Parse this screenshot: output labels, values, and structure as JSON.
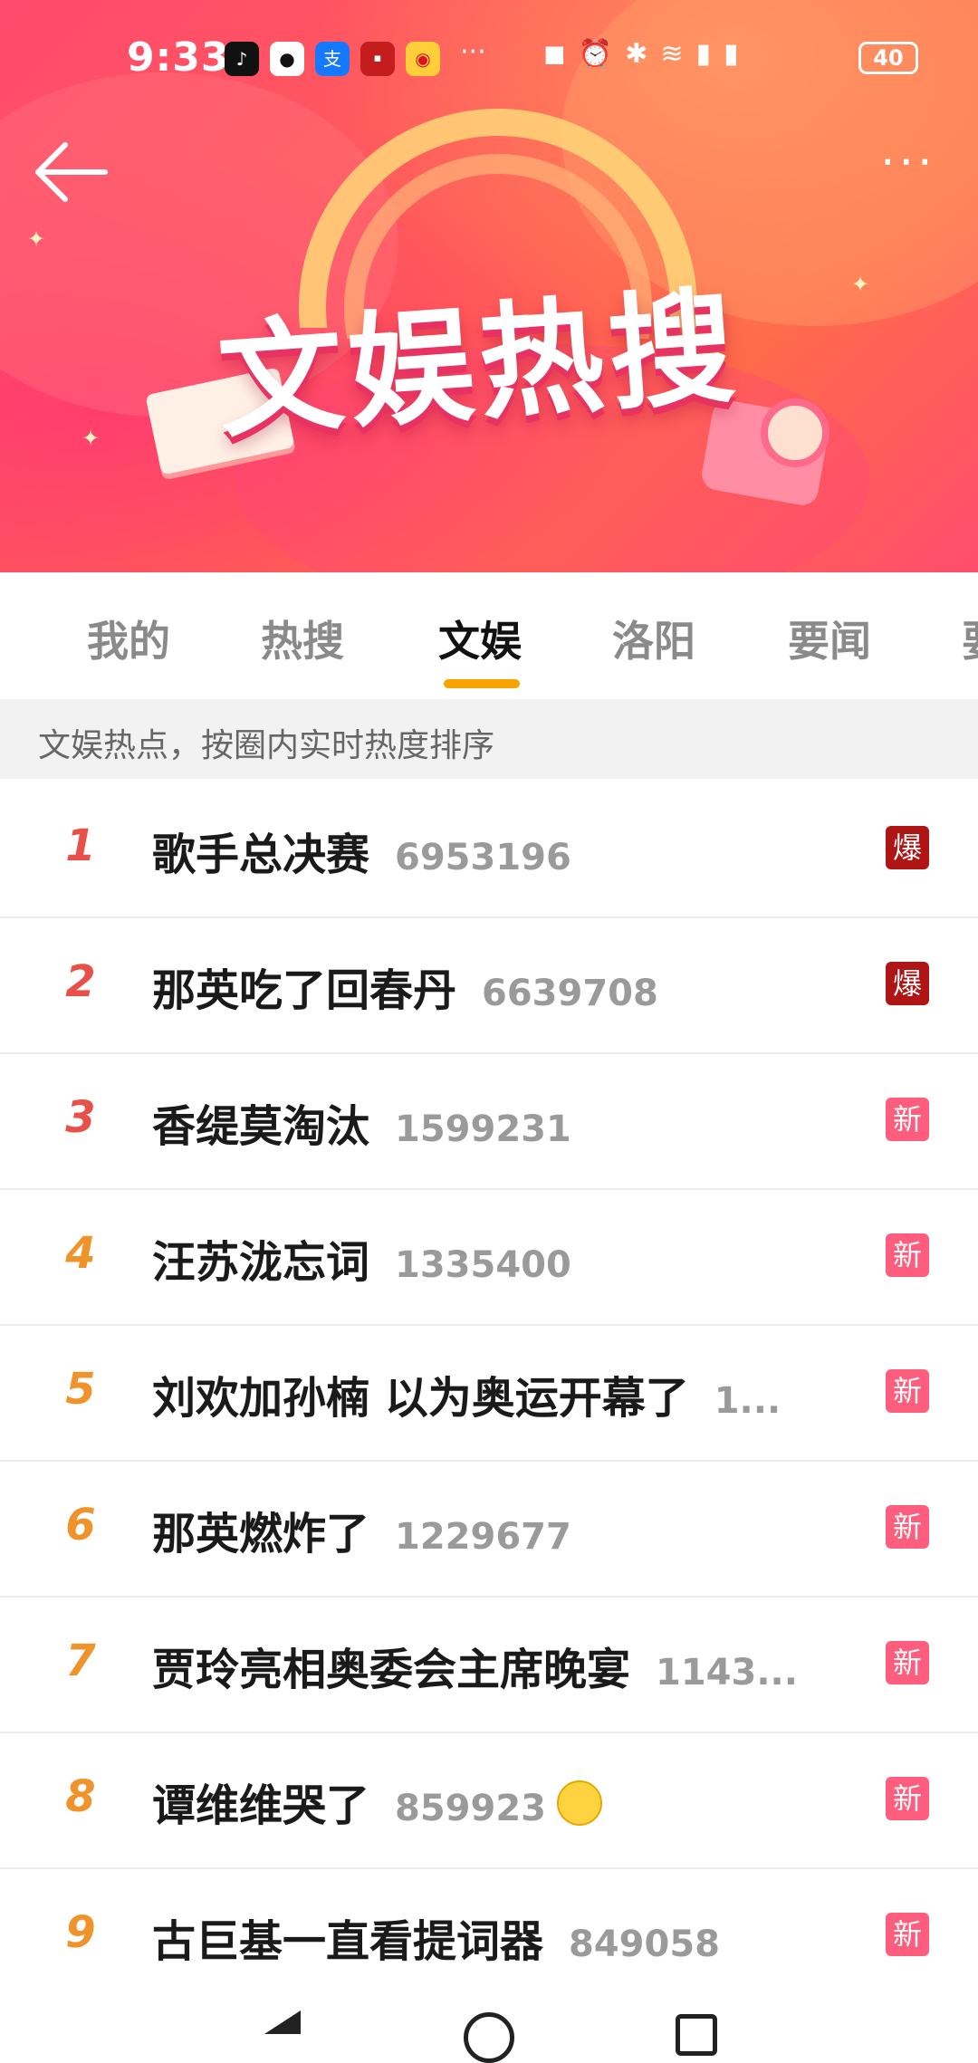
{
  "status_bar": {
    "time": "9:33",
    "battery": "40",
    "more_notifications": "···"
  },
  "banner": {
    "title": "文娱热搜",
    "more_icon": "···"
  },
  "tabs": [
    {
      "label": "我的"
    },
    {
      "label": "热搜"
    },
    {
      "label": "文娱"
    },
    {
      "label": "洛阳"
    },
    {
      "label": "要闻"
    },
    {
      "label": "要"
    }
  ],
  "subheader": "文娱热点，按圈内实时热度排序",
  "items": [
    {
      "rank": "1",
      "title": "歌手总决赛",
      "count": "6953196",
      "badge": "爆",
      "badge_type": "hot"
    },
    {
      "rank": "2",
      "title": "那英吃了回春丹",
      "count": "6639708",
      "badge": "爆",
      "badge_type": "hot"
    },
    {
      "rank": "3",
      "title": "香缇莫淘汰",
      "count": "1599231",
      "badge": "新",
      "badge_type": "new"
    },
    {
      "rank": "4",
      "title": "汪苏泷忘词",
      "count": "1335400",
      "badge": "新",
      "badge_type": "new"
    },
    {
      "rank": "5",
      "title": "刘欢加孙楠 以为奥运开幕了",
      "count": "1...",
      "badge": "新",
      "badge_type": "new"
    },
    {
      "rank": "6",
      "title": "那英燃炸了",
      "count": "1229677",
      "badge": "新",
      "badge_type": "new"
    },
    {
      "rank": "7",
      "title": "贾玲亮相奥委会主席晚宴",
      "count": "1143...",
      "badge": "新",
      "badge_type": "new"
    },
    {
      "rank": "8",
      "title": "谭维维哭了",
      "count": "859923",
      "badge": "新",
      "badge_type": "new"
    },
    {
      "rank": "9",
      "title": "古巨基一直看提词器",
      "count": "849058",
      "badge": "新",
      "badge_type": "new"
    }
  ],
  "colors": {
    "rank_top": "#e8504a",
    "rank_other": "#f0932b",
    "tab_accent": "#f7a400",
    "badge_hot": "#b01515",
    "badge_new": "#ff5d7d"
  }
}
